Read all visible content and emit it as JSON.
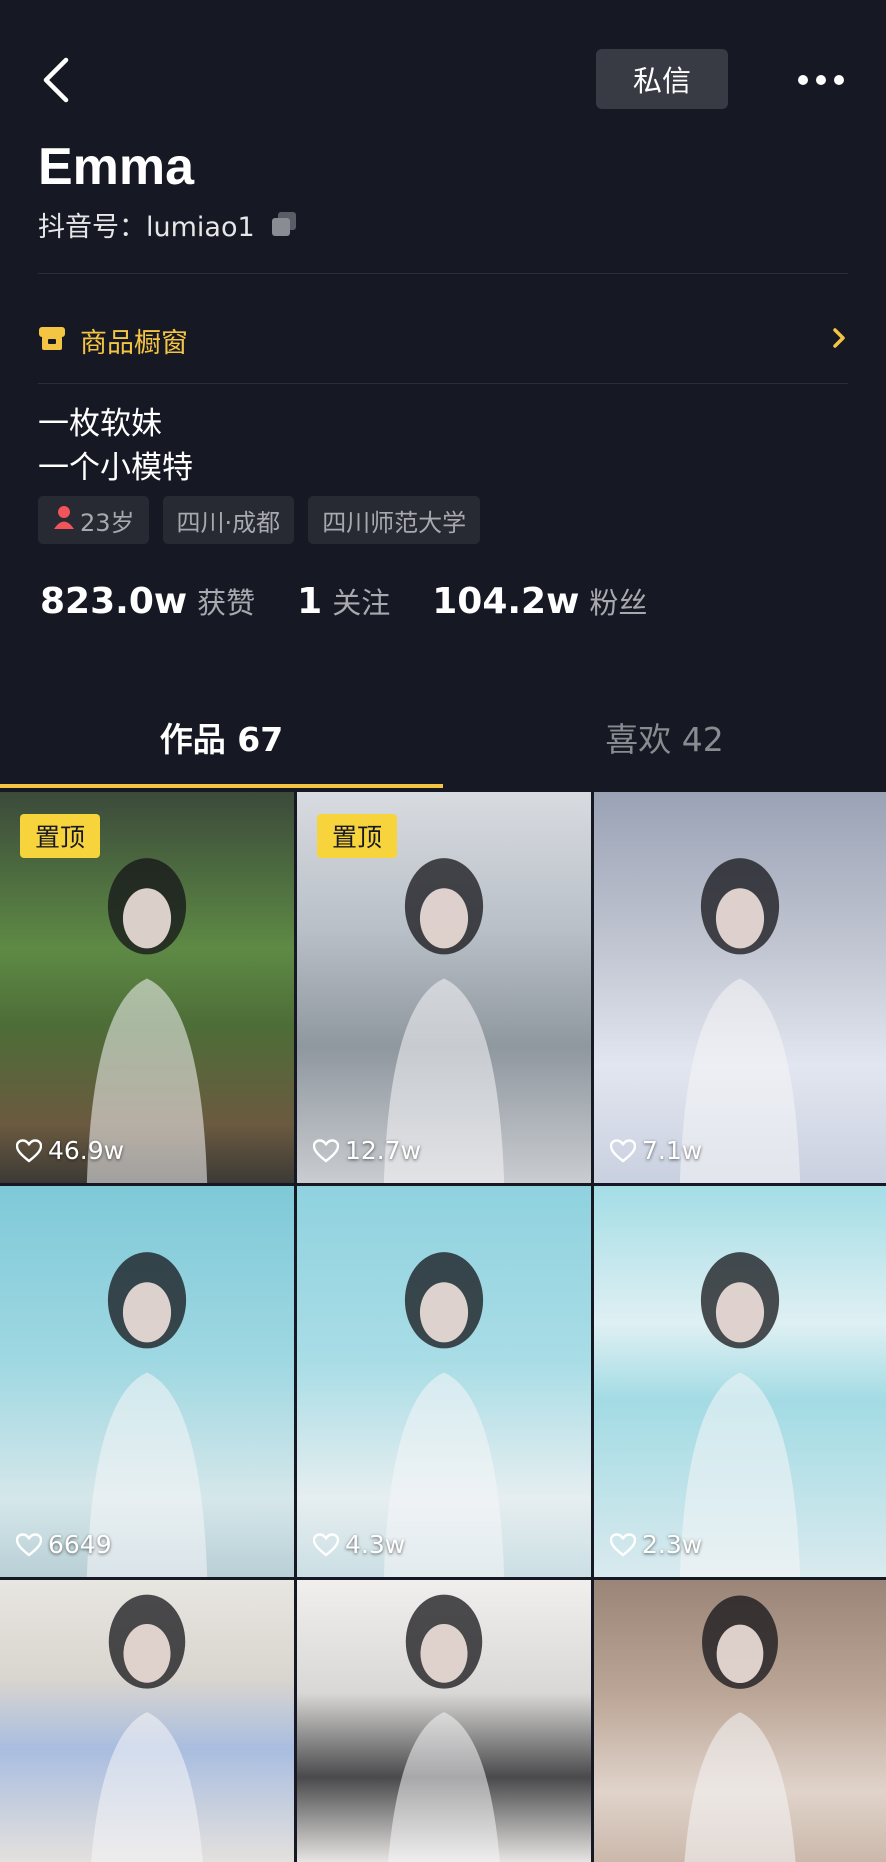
{
  "header": {
    "message_label": "私信",
    "name": "Emma",
    "douyin_id": "抖音号：lumiao1"
  },
  "shop": {
    "label": "商品橱窗"
  },
  "bio": [
    "一枚软妹",
    "一个小模特"
  ],
  "tags": {
    "age": "23岁",
    "location": "四川·成都",
    "school": "四川师范大学"
  },
  "stats": {
    "likes_count": "823.0w",
    "likes_label": "获赞",
    "following_count": "1",
    "following_label": "关注",
    "followers_count": "104.2w",
    "followers_label": "粉丝"
  },
  "tabs": {
    "works": "作品 67",
    "likes": "喜欢 42"
  },
  "videos": [
    {
      "pinned": "置顶",
      "likes": "46.9w"
    },
    {
      "pinned": "置顶",
      "likes": "12.7w"
    },
    {
      "likes": "7.1w"
    },
    {
      "likes": "6649"
    },
    {
      "likes": "4.3w"
    },
    {
      "likes": "2.3w"
    },
    {},
    {},
    {}
  ],
  "colors": {
    "background": "#161823",
    "accent": "#f4c443",
    "pinned_badge": "#f7d43c"
  },
  "icons": {
    "back": "chevron-left-icon",
    "more": "more-dots-icon",
    "copy": "copy-icon",
    "shop": "shop-icon",
    "chevron": "chevron-right-icon",
    "gender": "female-person-icon",
    "like": "heart-outline-icon"
  }
}
